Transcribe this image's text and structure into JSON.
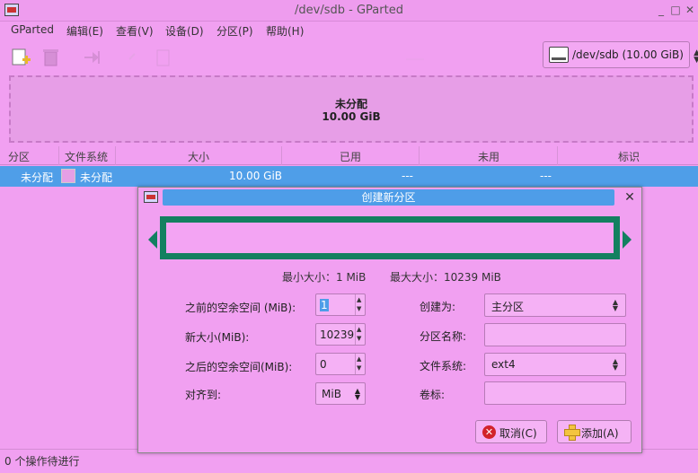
{
  "window": {
    "title": "/dev/sdb - GParted"
  },
  "menu": [
    "GParted",
    "编辑(E)",
    "查看(V)",
    "设备(D)",
    "分区(P)",
    "帮助(H)"
  ],
  "device": {
    "label": "/dev/sdb  (10.00 GiB)"
  },
  "partition_map": {
    "name": "未分配",
    "size": "10.00 GiB"
  },
  "table": {
    "headers": [
      "分区",
      "文件系统",
      "大小",
      "已用",
      "未用",
      "标识"
    ],
    "rows": [
      {
        "partition": "未分配",
        "filesystem": "未分配",
        "size": "10.00 GiB",
        "used": "---",
        "unused": "---",
        "flags": ""
      }
    ]
  },
  "status": "0 个操作待进行",
  "dialog": {
    "title": "创建新分区",
    "min_size": "最小大小：1 MiB",
    "max_size": "最大大小：10239 MiB",
    "fields": {
      "space_before_label": "之前的空余空间 (MiB):",
      "space_before_value": "1",
      "new_size_label": "新大小(MiB):",
      "new_size_value": "10239",
      "space_after_label": "之后的空余空间(MiB):",
      "space_after_value": "0",
      "align_label": "对齐到:",
      "align_value": "MiB",
      "create_as_label": "创建为:",
      "create_as_value": "主分区",
      "partition_name_label": "分区名称:",
      "partition_name_value": "",
      "filesystem_label": "文件系统:",
      "filesystem_value": "ext4",
      "volume_label_label": "卷标:",
      "volume_label_value": ""
    },
    "buttons": {
      "cancel": "取消(C)",
      "add": "添加(A)"
    }
  },
  "colors": {
    "background": "#f1a0f1",
    "selection": "#4f9ee8",
    "resizer_border": "#138060"
  }
}
